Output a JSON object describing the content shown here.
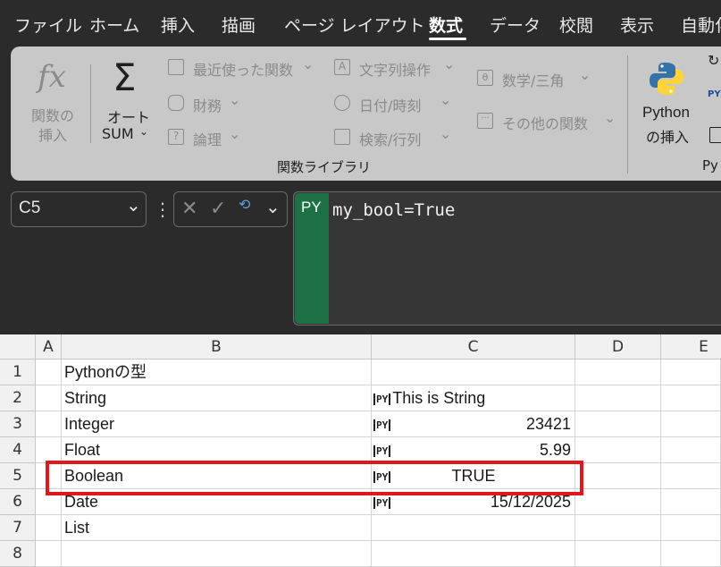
{
  "menu": {
    "tabs": [
      "ファイル",
      "ホーム",
      "挿入",
      "描画",
      "ページ レイアウト",
      "数式",
      "データ",
      "校閲",
      "表示",
      "自動化"
    ],
    "active_tab": "数式"
  },
  "ribbon": {
    "insert_function": {
      "line1": "関数の",
      "line2": "挿入"
    },
    "autosum": {
      "line1": "オート",
      "line2": "SUM"
    },
    "recently_used": "最近使った関数",
    "financial": "財務",
    "logical": "論理",
    "text": "文字列操作",
    "date_time": "日付/時刻",
    "lookup": "検索/行列",
    "math": "数学/三角",
    "more_functions": "その他の関数",
    "group_label": "関数ライブラリ",
    "python_insert": {
      "line1": "Python",
      "line2": "の挿入"
    },
    "python_group": "Py"
  },
  "formula_bar": {
    "name_box": "C5",
    "py_badge": "PY",
    "formula": "my_bool=True"
  },
  "sheet": {
    "columns": [
      "A",
      "B",
      "C",
      "D",
      "E"
    ],
    "rows": [
      "1",
      "2",
      "3",
      "4",
      "5",
      "6",
      "7",
      "8"
    ],
    "b": [
      "Pythonの型",
      "String",
      "Integer",
      "Float",
      "Boolean",
      "Date",
      "List",
      ""
    ],
    "c": [
      "",
      "This is String",
      "23421",
      "5.99",
      "TRUE",
      "15/12/2025",
      "",
      ""
    ],
    "py_icon_text": "PY"
  },
  "colors": {
    "py_green": "#1e7145",
    "highlight": "#e0181c"
  }
}
